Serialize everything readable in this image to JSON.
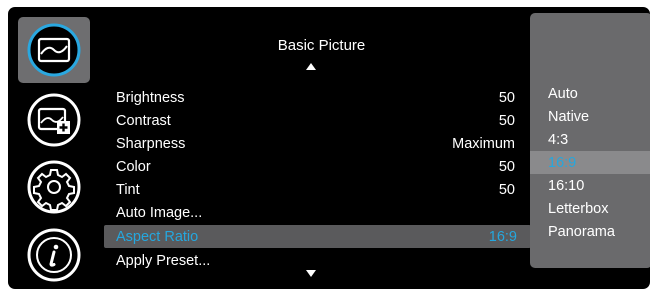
{
  "colors": {
    "background": "#000000",
    "selection_bg": "#5a5a5c",
    "options_panel_bg": "#6a6a6c",
    "highlight_text": "#25a7de",
    "text": "#ffffff",
    "icon_accent": "#2aa8e0"
  },
  "sidebar": {
    "icons": [
      {
        "name": "picture-icon",
        "selected": true
      },
      {
        "name": "display-setup-icon",
        "selected": false
      },
      {
        "name": "settings-gear-icon",
        "selected": false
      },
      {
        "name": "info-icon",
        "selected": false
      }
    ]
  },
  "menu": {
    "title": "Basic Picture",
    "items": [
      {
        "label": "Brightness",
        "value": "50"
      },
      {
        "label": "Contrast",
        "value": "50"
      },
      {
        "label": "Sharpness",
        "value": "Maximum"
      },
      {
        "label": "Color",
        "value": "50"
      },
      {
        "label": "Tint",
        "value": "50"
      },
      {
        "label": "Auto Image...",
        "value": ""
      },
      {
        "label": "Aspect Ratio",
        "value": "16:9",
        "selected": true
      },
      {
        "label": "Apply Preset...",
        "value": ""
      }
    ]
  },
  "aspect_options": {
    "items": [
      "Auto",
      "Native",
      "4:3",
      "16:9",
      "16:10",
      "Letterbox",
      "Panorama"
    ],
    "selected": "16:9"
  }
}
